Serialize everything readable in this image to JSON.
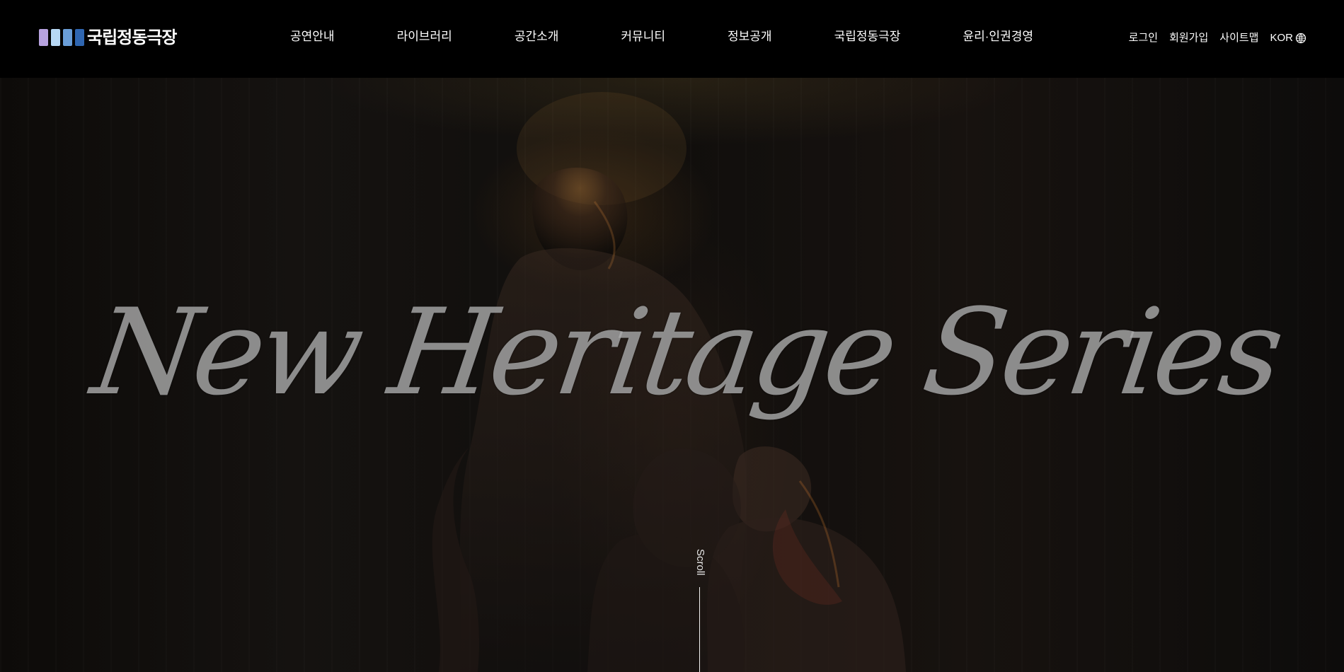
{
  "header": {
    "logo": {
      "text": "국립정동극장",
      "bar_colors": [
        "#b7a2df",
        "#b7d8f4",
        "#6a9ed8",
        "#2f66b1"
      ]
    },
    "nav": {
      "items": [
        {
          "label": "공연안내"
        },
        {
          "label": "라이브러리"
        },
        {
          "label": "공간소개"
        },
        {
          "label": "커뮤니티"
        },
        {
          "label": "정보공개"
        },
        {
          "label": "국립정동극장"
        },
        {
          "label": "윤리·인권경영"
        }
      ]
    },
    "utility": {
      "login": "로그인",
      "signup": "회원가입",
      "sitemap": "사이트맵",
      "language": "KOR",
      "language_icon": "globe-icon"
    }
  },
  "hero": {
    "title": "New Heritage Series",
    "scroll_label": "Scroll"
  },
  "colors": {
    "background": "#000000",
    "text": "#ffffff",
    "hero_title": "#aaaaaa"
  }
}
